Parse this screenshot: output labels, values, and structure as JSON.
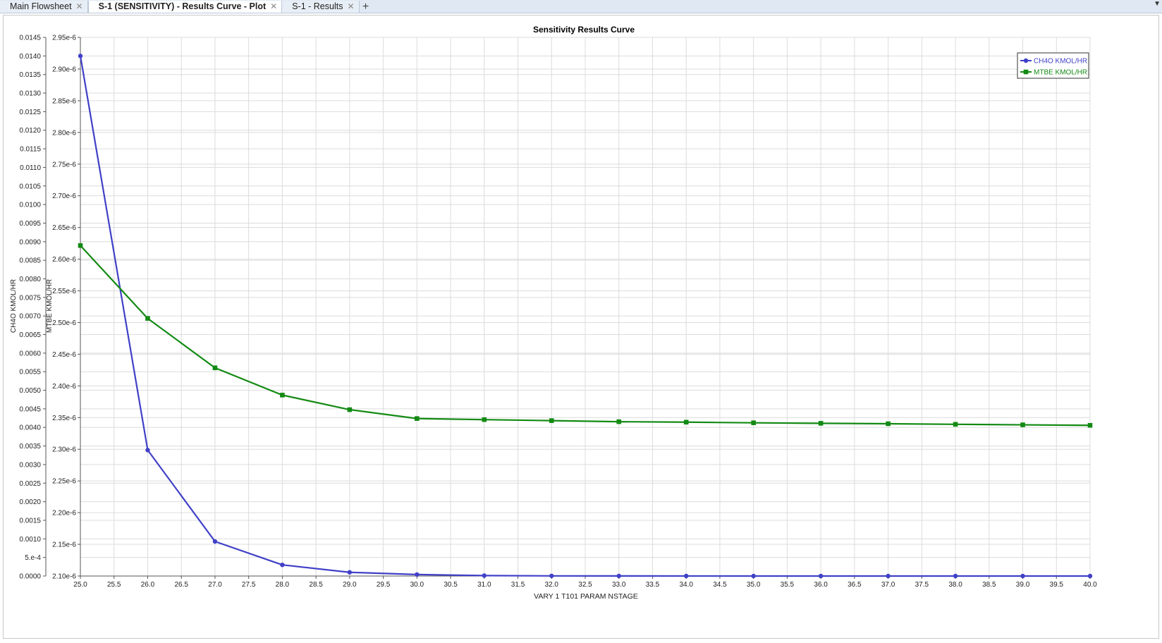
{
  "tabs": [
    {
      "label": "Main Flowsheet",
      "active": false
    },
    {
      "label": "S-1 (SENSITIVITY) - Results Curve - Plot",
      "active": true
    },
    {
      "label": "S-1 - Results",
      "active": false
    }
  ],
  "chart_data": {
    "type": "line",
    "title": "Sensitivity Results Curve",
    "xlabel": "VARY   1 T101 PARAM NSTAGE",
    "x": [
      25.0,
      26.0,
      27.0,
      28.0,
      29.0,
      30.0,
      31.0,
      32.0,
      33.0,
      34.0,
      35.0,
      36.0,
      37.0,
      38.0,
      39.0,
      40.0
    ],
    "xlim": [
      25.0,
      40.0
    ],
    "xticks": [
      "25.0",
      "25.5",
      "26.0",
      "26.5",
      "27.0",
      "27.5",
      "28.0",
      "28.5",
      "29.0",
      "29.5",
      "30.0",
      "30.5",
      "31.0",
      "31.5",
      "32.0",
      "32.5",
      "33.0",
      "33.5",
      "34.0",
      "34.5",
      "35.0",
      "35.5",
      "36.0",
      "36.5",
      "37.0",
      "37.5",
      "38.0",
      "38.5",
      "39.0",
      "39.5",
      "40.0"
    ],
    "grid": true,
    "legend_position": "top-right",
    "y_axes": [
      {
        "label": "CH4O KMOL/HR",
        "ylim": [
          0.0,
          0.0145
        ],
        "ticks": [
          "0.0000",
          "5.e-4",
          "0.0010",
          "0.0015",
          "0.0020",
          "0.0025",
          "0.0030",
          "0.0035",
          "0.0040",
          "0.0045",
          "0.0050",
          "0.0055",
          "0.0060",
          "0.0065",
          "0.0070",
          "0.0075",
          "0.0080",
          "0.0085",
          "0.0090",
          "0.0095",
          "0.0100",
          "0.0105",
          "0.0110",
          "0.0115",
          "0.0120",
          "0.0125",
          "0.0130",
          "0.0135",
          "0.0140",
          "0.0145"
        ]
      },
      {
        "label": "MTBE KMOL/HR",
        "ylim": [
          2.1e-06,
          2.95e-06
        ],
        "ticks": [
          "2.10e-6",
          "2.15e-6",
          "2.20e-6",
          "2.25e-6",
          "2.30e-6",
          "2.35e-6",
          "2.40e-6",
          "2.45e-6",
          "2.50e-6",
          "2.55e-6",
          "2.60e-6",
          "2.65e-6",
          "2.70e-6",
          "2.75e-6",
          "2.80e-6",
          "2.85e-6",
          "2.90e-6",
          "2.95e-6"
        ]
      }
    ],
    "series": [
      {
        "name": "CH4O KMOL/HR",
        "axis": 0,
        "marker": "circle",
        "color": "#4040c8",
        "values": [
          0.014,
          0.00339,
          0.00093,
          0.0003,
          0.0001,
          4e-05,
          1.2e-05,
          4e-06,
          2e-06,
          1e-06,
          5e-07,
          3e-07,
          2e-07,
          1e-07,
          1e-07,
          1e-07
        ]
      },
      {
        "name": "MTBE KMOL/HR",
        "axis": 1,
        "marker": "square",
        "color": "#138a13",
        "values": [
          2.6215e-06,
          2.5065e-06,
          2.4285e-06,
          2.3855e-06,
          2.3625e-06,
          2.3485e-06,
          2.3468e-06,
          2.3452e-06,
          2.3435e-06,
          2.3428e-06,
          2.3418e-06,
          2.341e-06,
          2.3403e-06,
          2.3394e-06,
          2.3386e-06,
          2.3378e-06
        ]
      }
    ]
  }
}
